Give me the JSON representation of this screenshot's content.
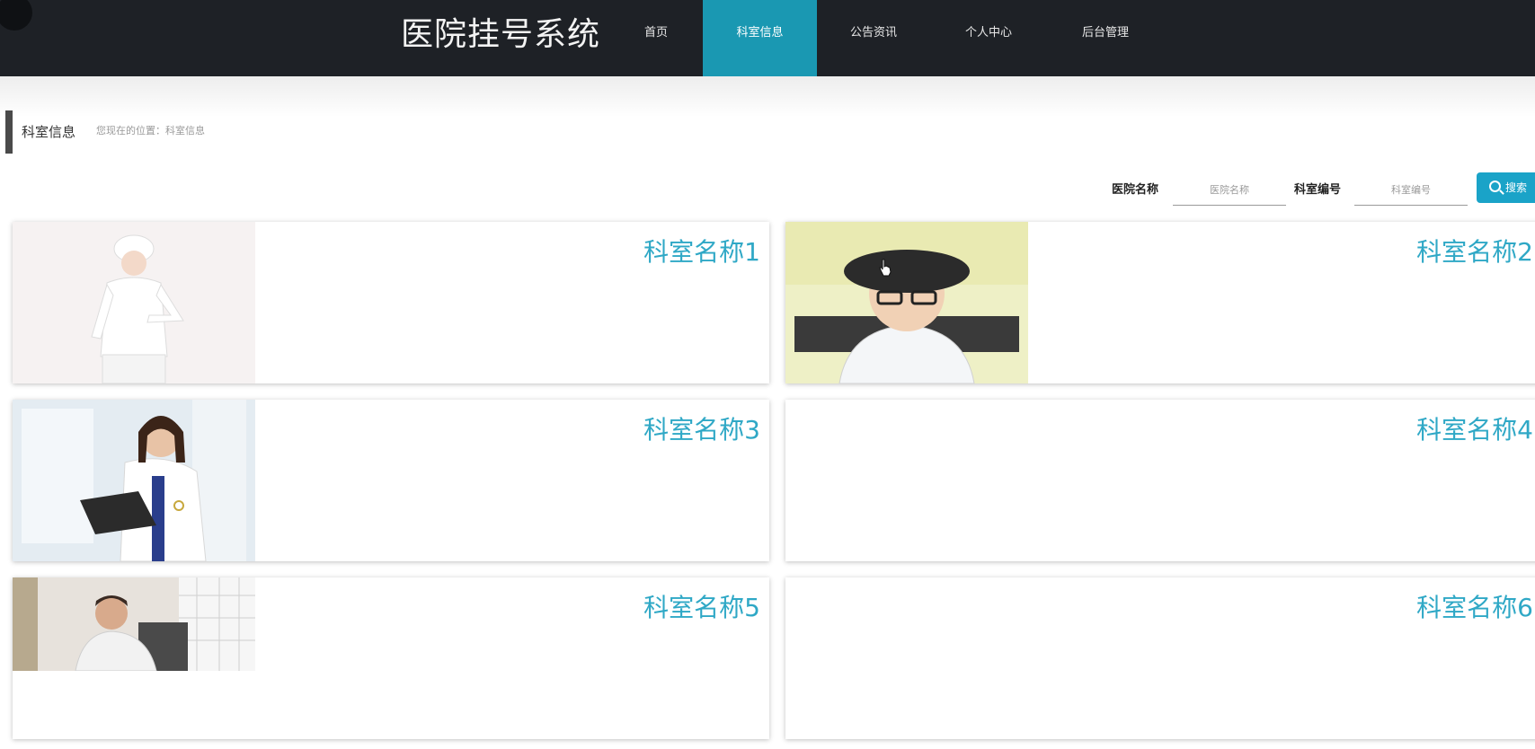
{
  "header": {
    "title": "医院挂号系统",
    "nav": [
      {
        "label": "首页",
        "active": false
      },
      {
        "label": "科室信息",
        "active": true
      },
      {
        "label": "公告资讯",
        "active": false
      },
      {
        "label": "个人中心",
        "active": false
      },
      {
        "label": "后台管理",
        "active": false
      }
    ]
  },
  "breadcrumb": {
    "title": "科室信息",
    "location": "您现在的位置：科室信息"
  },
  "search": {
    "hospital_label": "医院名称",
    "hospital_placeholder": "医院名称",
    "dept_label": "科室编号",
    "dept_placeholder": "科室编号",
    "button_label": "搜索"
  },
  "departments": [
    {
      "name": "科室名称1",
      "photo": "nurse-photo"
    },
    {
      "name": "科室名称2",
      "photo": "doctor-photo"
    },
    {
      "name": "科室名称3",
      "photo": "doctor-photo"
    },
    {
      "name": "科室名称4",
      "photo": ""
    },
    {
      "name": "科室名称5",
      "photo": "doctor-photo"
    },
    {
      "name": "科室名称6",
      "photo": ""
    }
  ],
  "colors": {
    "header_bg": "#1e2126",
    "accent": "#1a98b2",
    "card_title": "#2fa8c6",
    "search_button": "#1aa3c8"
  }
}
